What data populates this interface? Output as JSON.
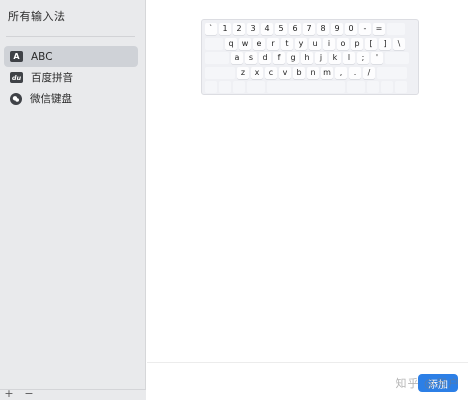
{
  "sidebar": {
    "title": "所有输入法",
    "items": [
      {
        "label": "ABC",
        "icon": "abc-input-icon",
        "icon_text": "A",
        "selected": true
      },
      {
        "label": "百度拼音",
        "icon": "baidu-pinyin-icon",
        "icon_text": "du",
        "selected": false
      },
      {
        "label": "微信键盘",
        "icon": "wechat-keyboard-icon",
        "icon_text": "",
        "selected": false
      }
    ],
    "add_label": "+",
    "remove_label": "−"
  },
  "keyboard": {
    "rows": [
      [
        "`",
        "1",
        "2",
        "3",
        "4",
        "5",
        "6",
        "7",
        "8",
        "9",
        "0",
        "-",
        "="
      ],
      [
        "q",
        "w",
        "e",
        "r",
        "t",
        "y",
        "u",
        "i",
        "o",
        "p",
        "[",
        "]",
        "\\"
      ],
      [
        "a",
        "s",
        "d",
        "f",
        "g",
        "h",
        "j",
        "k",
        "l",
        ";",
        "'"
      ],
      [
        "z",
        "x",
        "c",
        "v",
        "b",
        "n",
        "m",
        ",",
        ".",
        "/"
      ]
    ]
  },
  "footer": {
    "add_button_label": "添加",
    "watermark": "知乎 @用户"
  },
  "colors": {
    "accent": "#2c7fe6",
    "sidebar_bg": "#e9eaec",
    "selected_bg": "#cfd2d7"
  }
}
